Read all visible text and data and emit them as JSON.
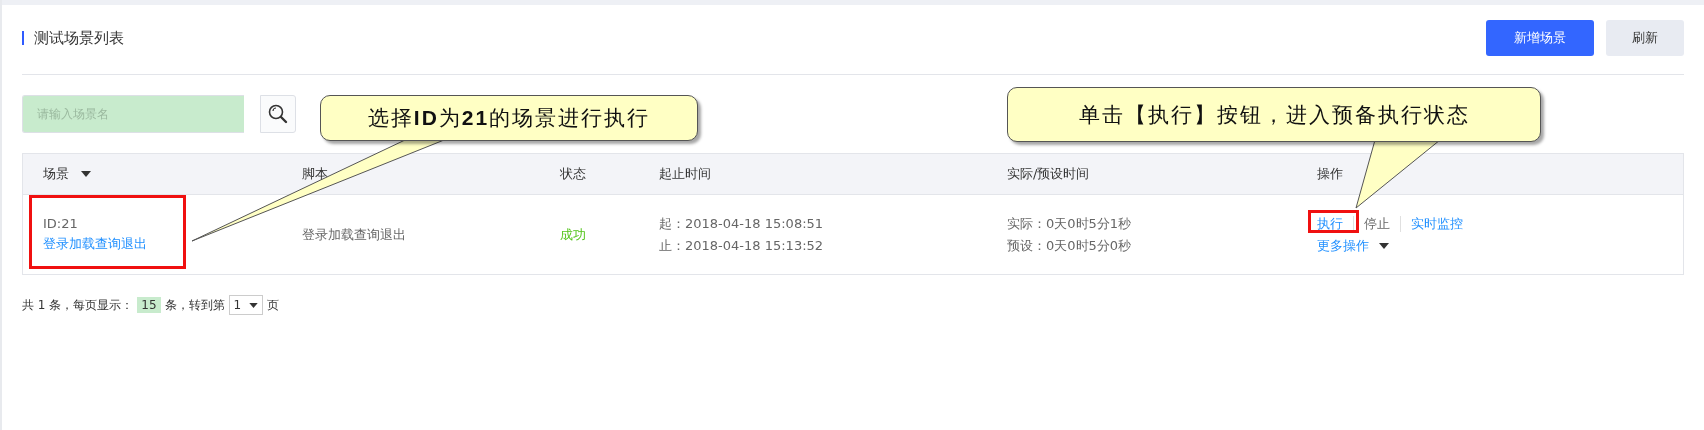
{
  "header": {
    "title": "测试场景列表",
    "buttons": [
      {
        "label": "新增场景",
        "kind": "primary"
      },
      {
        "label": "刷新",
        "kind": "default"
      }
    ]
  },
  "search": {
    "placeholder": "请输入场景名"
  },
  "table": {
    "columns": [
      "场景",
      "脚本",
      "状态",
      "起止时间",
      "实际/预设时间",
      "操作"
    ],
    "rows": [
      {
        "id": "ID:21",
        "name": "登录加载查询退出",
        "script": "登录加载查询退出",
        "status": "成功",
        "start": "起：2018-04-18 15:08:51",
        "end": "止：2018-04-18 15:13:52",
        "actual": "实际：0天0时5分1秒",
        "preset": "预设：0天0时5分0秒",
        "actions": [
          {
            "label": "执行",
            "kind": "link"
          },
          {
            "label": "停止",
            "kind": "text"
          },
          {
            "label": "实时监控",
            "kind": "link"
          }
        ],
        "more": "更多操作"
      }
    ]
  },
  "pagination": {
    "prefix": "共 1 条，每页显示：",
    "page_size": "15",
    "middle": "条，转到第",
    "page": "1",
    "suffix": "页"
  },
  "callouts": [
    {
      "text": "选择**ID**为**21**的场景进行执行"
    },
    {
      "text": "单击【执行】按钮，进入预备执行状态"
    }
  ]
}
